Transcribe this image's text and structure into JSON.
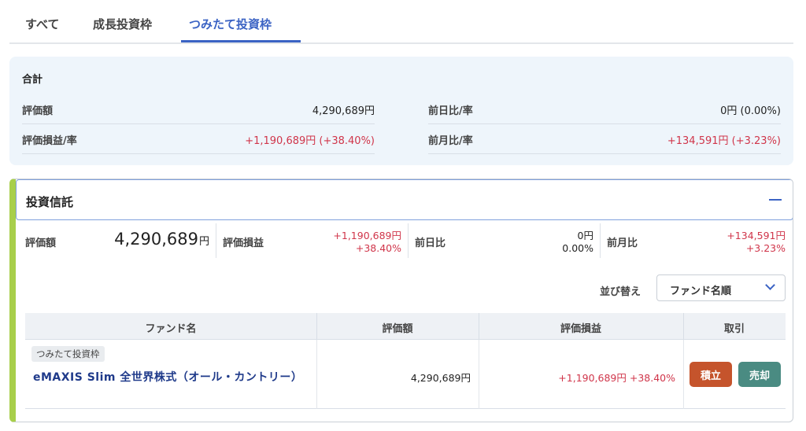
{
  "tabs": [
    {
      "label": "すべて"
    },
    {
      "label": "成長投資枠"
    },
    {
      "label": "つみたて投資枠"
    }
  ],
  "active_tab": "つみたて投資枠",
  "summary": {
    "title": "合計",
    "valuation_label": "評価額",
    "valuation_value": "4,290,689円",
    "prev_day_label": "前日比/率",
    "prev_day_value": "0円 (0.00%)",
    "gain_label": "評価損益/率",
    "gain_value": "+1,190,689円 (+38.40%)",
    "prev_month_label": "前月比/率",
    "prev_month_value": "+134,591円 (+3.23%)"
  },
  "fund_section": {
    "title": "投資信託",
    "valuation_label": "評価額",
    "valuation_amount": "4,290,689",
    "valuation_unit": "円",
    "gain_label": "評価損益",
    "gain_amount": "+1,190,689円",
    "gain_rate": "+38.40%",
    "prev_day_label": "前日比",
    "prev_day_amount": "0円",
    "prev_day_rate": "0.00%",
    "prev_month_label": "前月比",
    "prev_month_amount": "+134,591円",
    "prev_month_rate": "+3.23%",
    "sort_label": "並び替え",
    "sort_value": "ファンド名順",
    "table": {
      "headers": [
        "ファンド名",
        "評価額",
        "評価損益",
        "取引"
      ],
      "rows": [
        {
          "badge": "つみたて投資枠",
          "fund_name": "eMAXIS Slim 全世界株式（オール・カントリー）",
          "valuation": "4,290,689円",
          "gain": "+1,190,689円 +38.40%",
          "buy_label": "積立",
          "sell_label": "売却"
        }
      ]
    }
  },
  "colors": {
    "accent": "#3b63c4",
    "positive": "#d0354a",
    "card_stripe": "#a8cf4b",
    "buy_button": "#c5542c",
    "sell_button": "#4a8b82"
  },
  "icons": {
    "collapse": "minus-icon",
    "sort_dropdown": "chevron-down-icon"
  }
}
